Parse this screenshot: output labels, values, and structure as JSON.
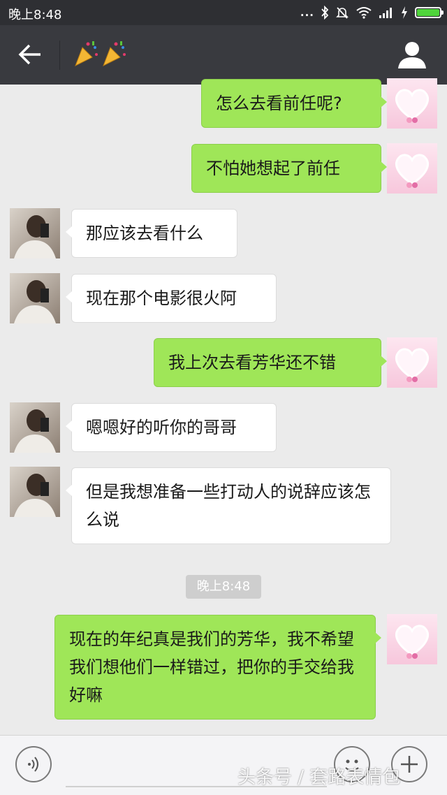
{
  "status_bar": {
    "time": "晚上8:48",
    "dots": "...",
    "icons": [
      "bluetooth-icon",
      "mute-icon",
      "wifi-icon",
      "signal-icon",
      "charging-icon",
      "battery-icon"
    ],
    "battery_level": 1.0
  },
  "header": {
    "title_emoji": "🎉🎉",
    "back_icon": "arrow-left-icon",
    "profile_icon": "person-icon"
  },
  "messages": [
    {
      "sender": "me",
      "text": "怎么去看前任呢?"
    },
    {
      "sender": "me",
      "text": "不怕她想起了前任"
    },
    {
      "sender": "other",
      "text": "那应该去看什么"
    },
    {
      "sender": "other",
      "text": "现在那个电影很火阿"
    },
    {
      "sender": "me",
      "text": "我上次去看芳华还不错"
    },
    {
      "sender": "other",
      "text": "嗯嗯好的听你的哥哥"
    },
    {
      "sender": "other",
      "text": "但是我想准备一些打动人的说辞应该怎么说"
    },
    {
      "sender": "me",
      "text": "现在的年纪真是我们的芳华，我不希望我们想他们一样错过，把你的手交给我好嘛"
    }
  ],
  "timestamp": "晚上8:48",
  "input_bar": {
    "voice_icon": "voice-icon",
    "emoji_icon": "smiley-icon",
    "plus_icon": "plus-icon",
    "input_value": ""
  },
  "watermark": "头条号 / 套路表情包",
  "colors": {
    "my_bubble": "#9fe658",
    "their_bubble": "#ffffff",
    "header": "#393a3f",
    "background": "#ebebeb"
  }
}
